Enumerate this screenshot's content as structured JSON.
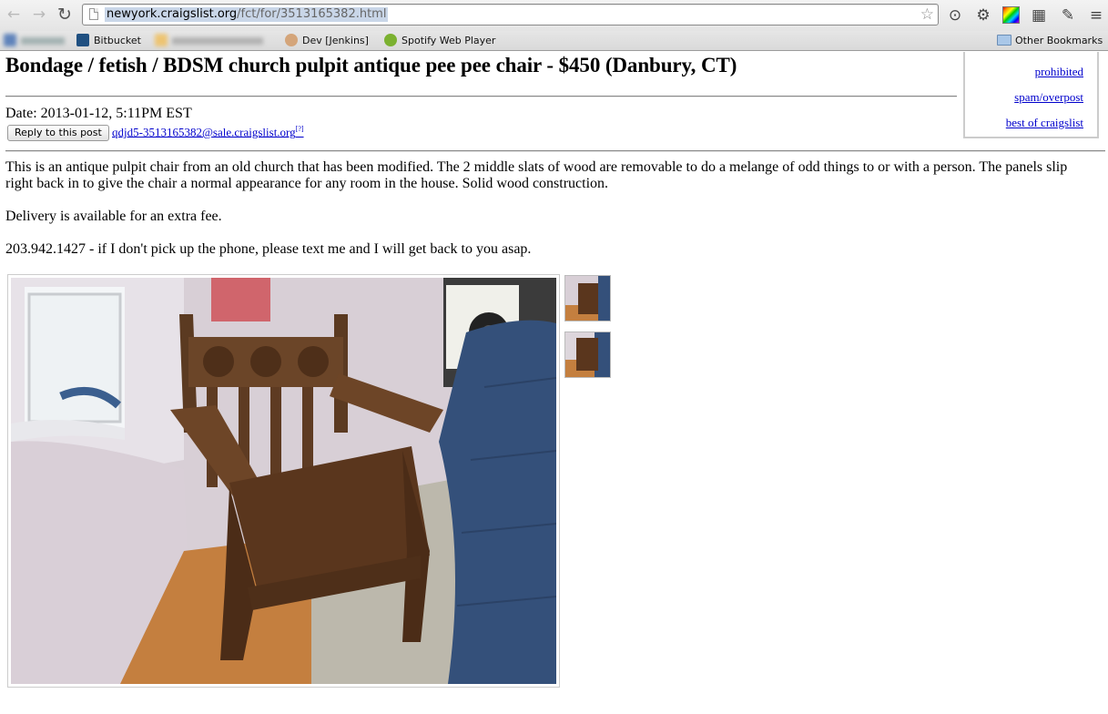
{
  "browser": {
    "url_host": "newyork.craigslist.org",
    "url_path": "/fct/for/3513165382.html",
    "bookmarks": [
      {
        "label": "Bitbucket"
      },
      {
        "label": "Dev [Jenkins]"
      },
      {
        "label": "Spotify Web Player"
      }
    ],
    "other_bookmarks": "Other Bookmarks"
  },
  "flag_box": {
    "links": [
      "prohibited",
      "spam/overpost",
      "best of craigslist"
    ]
  },
  "posting": {
    "title": "Bondage / fetish / BDSM church pulpit antique pee pee chair - $450 (Danbury, CT)",
    "date": "Date: 2013-01-12, 5:11PM EST",
    "reply_button": "Reply to this post",
    "reply_email": "qdjd5-3513165382@sale.craigslist.org",
    "reply_help": "[?]",
    "body": [
      "This is an antique pulpit chair from an old church that has been modified. The 2 middle slats of wood are removable to do a melange of odd things to or with a person. The panels slip right back in to give the chair a normal appearance for any room in the house. Solid wood construction.",
      "Delivery is available for an extra fee.",
      "203.942.1427 - if I don't pick up the phone, please text me and I will get back to you asap."
    ]
  },
  "colors": {
    "link": "#0000cc",
    "url_highlight": "#c9d6e8"
  }
}
